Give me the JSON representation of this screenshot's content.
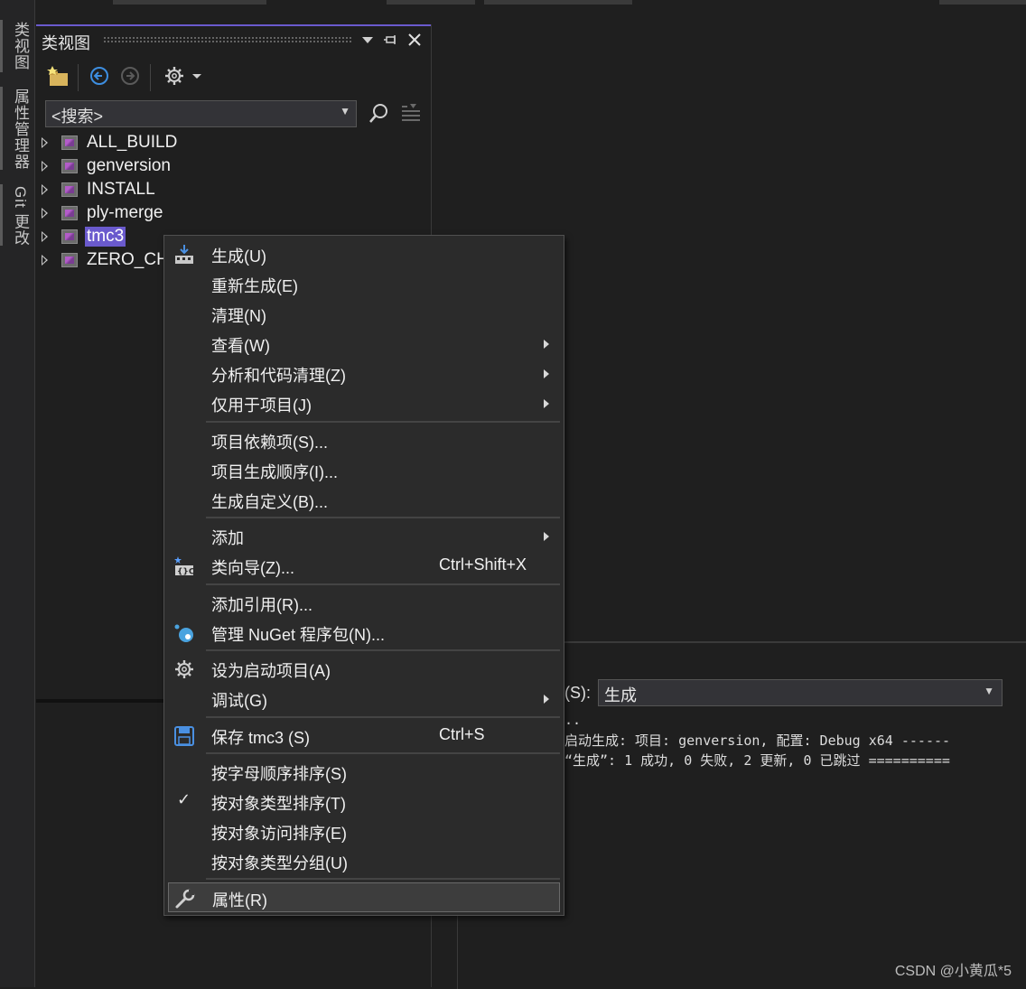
{
  "side_tabs": [
    "类视图",
    "属性管理器",
    "Git 更改"
  ],
  "class_view": {
    "title": "类视图",
    "search_placeholder": "<搜索>",
    "tree": [
      {
        "label": "ALL_BUILD",
        "selected": false
      },
      {
        "label": "genversion",
        "selected": false
      },
      {
        "label": "INSTALL",
        "selected": false
      },
      {
        "label": "ply-merge",
        "selected": false
      },
      {
        "label": "tmc3",
        "selected": true
      },
      {
        "label": "ZERO_CHE",
        "selected": false
      }
    ]
  },
  "output": {
    "label": "(S):",
    "selected": "生成",
    "lines": [
      "..",
      "启动生成: 项目: genversion, 配置: Debug x64 ------",
      "“生成”: 1 成功, 0 失败, 2 更新, 0 已跳过 =========="
    ]
  },
  "context_menu": {
    "items": [
      {
        "label": "生成(U)",
        "icon": "build-icon"
      },
      {
        "label": "重新生成(E)"
      },
      {
        "label": "清理(N)"
      },
      {
        "label": "查看(W)",
        "submenu": true
      },
      {
        "label": "分析和代码清理(Z)",
        "submenu": true
      },
      {
        "label": "仅用于项目(J)",
        "submenu": true
      },
      {
        "label": "项目依赖项(S)..."
      },
      {
        "label": "项目生成顺序(I)..."
      },
      {
        "label": "生成自定义(B)..."
      },
      {
        "label": "添加",
        "submenu": true
      },
      {
        "label": "类向导(Z)...",
        "shortcut": "Ctrl+Shift+X",
        "icon": "class-wizard-icon"
      },
      {
        "label": "添加引用(R)..."
      },
      {
        "label": "管理 NuGet 程序包(N)...",
        "icon": "nuget-icon"
      },
      {
        "label": "设为启动项目(A)",
        "icon": "gear-icon"
      },
      {
        "label": "调试(G)",
        "submenu": true
      },
      {
        "label": "保存 tmc3 (S)",
        "shortcut": "Ctrl+S",
        "icon": "save-icon"
      },
      {
        "label": "按字母顺序排序(S)"
      },
      {
        "label": "按对象类型排序(T)",
        "checked": true
      },
      {
        "label": "按对象访问排序(E)"
      },
      {
        "label": "按对象类型分组(U)"
      },
      {
        "label": "属性(R)",
        "icon": "wrench-icon",
        "highlighted": true
      }
    ],
    "check_mark": "✓"
  },
  "watermark": "CSDN @小黄瓜*5"
}
